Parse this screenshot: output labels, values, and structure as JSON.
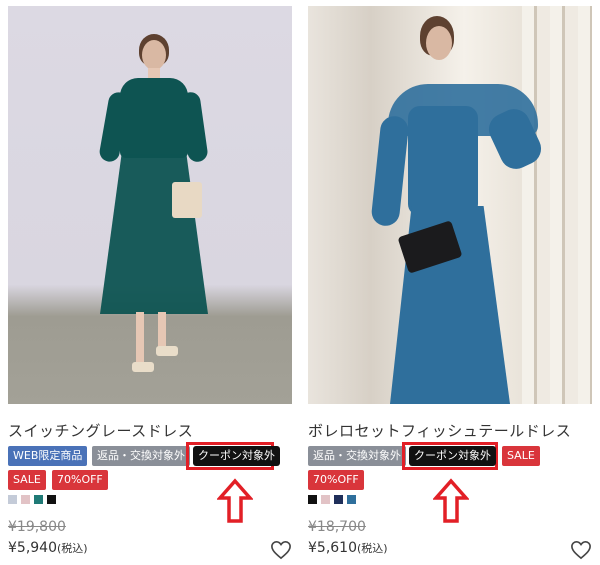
{
  "products": [
    {
      "title": "スイッチングレースドレス",
      "tags": {
        "web": "WEB限定商品",
        "returns": "返品・交換対象外",
        "coupon": "クーポン対象外",
        "sale": "SALE",
        "discount": "70%OFF"
      },
      "swatch_colors": [
        "#c4cbd8",
        "#e2c3c6",
        "#1f7a76",
        "#111111"
      ],
      "price_original": "¥19,800",
      "price_sale": "¥5,940",
      "tax_label": "(税込)"
    },
    {
      "title": "ボレロセットフィッシュテールドレス",
      "tags": {
        "returns": "返品・交換対象外",
        "coupon": "クーポン対象外",
        "sale": "SALE",
        "discount": "70%OFF"
      },
      "swatch_colors": [
        "#111111",
        "#e2c3c6",
        "#1f2f5a",
        "#2f6f9c"
      ],
      "price_original": "¥18,700",
      "price_sale": "¥5,610",
      "tax_label": "(税込)"
    }
  ],
  "highlight_color": "#e21f26"
}
